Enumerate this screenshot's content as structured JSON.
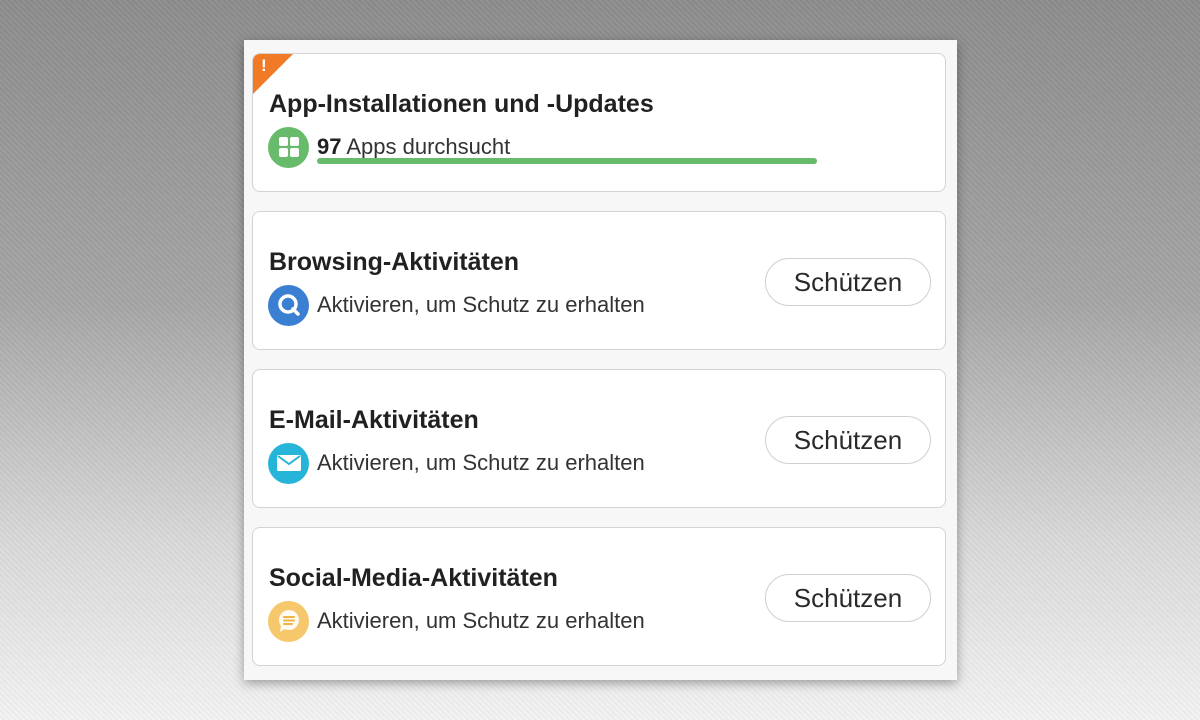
{
  "cards": [
    {
      "title": "App-Installationen und -Updates",
      "count": "97",
      "subtitle": " Apps durchsucht",
      "progress": 1.0,
      "warning_mark": "!",
      "icon": "apps-grid-icon",
      "icon_color": "#69bb6c",
      "warning_color": "#f07a26"
    },
    {
      "title": "Browsing-Aktivitäten",
      "subtitle": "Aktivieren, um Schutz zu erhalten",
      "button": "Schützen",
      "icon": "search-icon",
      "icon_color": "#3b7fd2"
    },
    {
      "title": "E-Mail-Aktivitäten",
      "subtitle": "Aktivieren, um Schutz zu erhalten",
      "button": "Schützen",
      "icon": "mail-icon",
      "icon_color": "#26b5d8"
    },
    {
      "title": "Social-Media-Aktivitäten",
      "subtitle": "Aktivieren, um Schutz zu erhalten",
      "button": "Schützen",
      "icon": "chat-bubble-icon",
      "icon_color": "#f6c86b"
    }
  ]
}
